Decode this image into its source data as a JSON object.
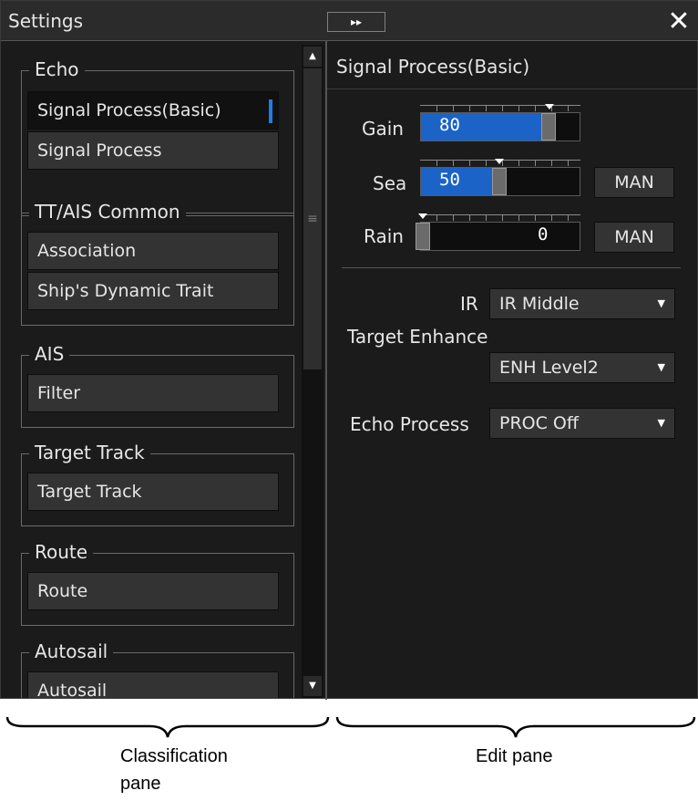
{
  "window": {
    "title": "Settings",
    "expand_glyph": "▸▸",
    "close_glyph": "✕"
  },
  "classification": {
    "groups": [
      {
        "label": "Echo",
        "items": [
          "Signal Process(Basic)",
          "Signal Process"
        ]
      },
      {
        "label": "TT/AIS Common",
        "items": [
          "Association",
          "Ship's Dynamic Trait"
        ]
      },
      {
        "label": "AIS",
        "items": [
          "Filter"
        ]
      },
      {
        "label": "Target Track",
        "items": [
          "Target Track"
        ]
      },
      {
        "label": "Route",
        "items": [
          "Route"
        ]
      },
      {
        "label": "Autosail",
        "items": [
          "Autosail"
        ]
      }
    ],
    "selected": "Signal Process(Basic)"
  },
  "edit": {
    "title": "Signal Process(Basic)",
    "gain": {
      "label": "Gain",
      "value": "80"
    },
    "sea": {
      "label": "Sea",
      "value": "50",
      "mode": "MAN"
    },
    "rain": {
      "label": "Rain",
      "value": "0",
      "mode": "MAN"
    },
    "ir": {
      "label": "IR",
      "value": "IR Middle"
    },
    "target_enhance": {
      "label": "Target Enhance",
      "value": "ENH Level2"
    },
    "echo_process": {
      "label": "Echo Process",
      "value": "PROC Off"
    }
  },
  "captions": {
    "left_line1": "Classification",
    "left_line2": "pane",
    "right": "Edit pane"
  },
  "colors": {
    "accent": "#1e7fe0",
    "slider_fill": "#1b63c6",
    "background": "#1b1b1b"
  }
}
